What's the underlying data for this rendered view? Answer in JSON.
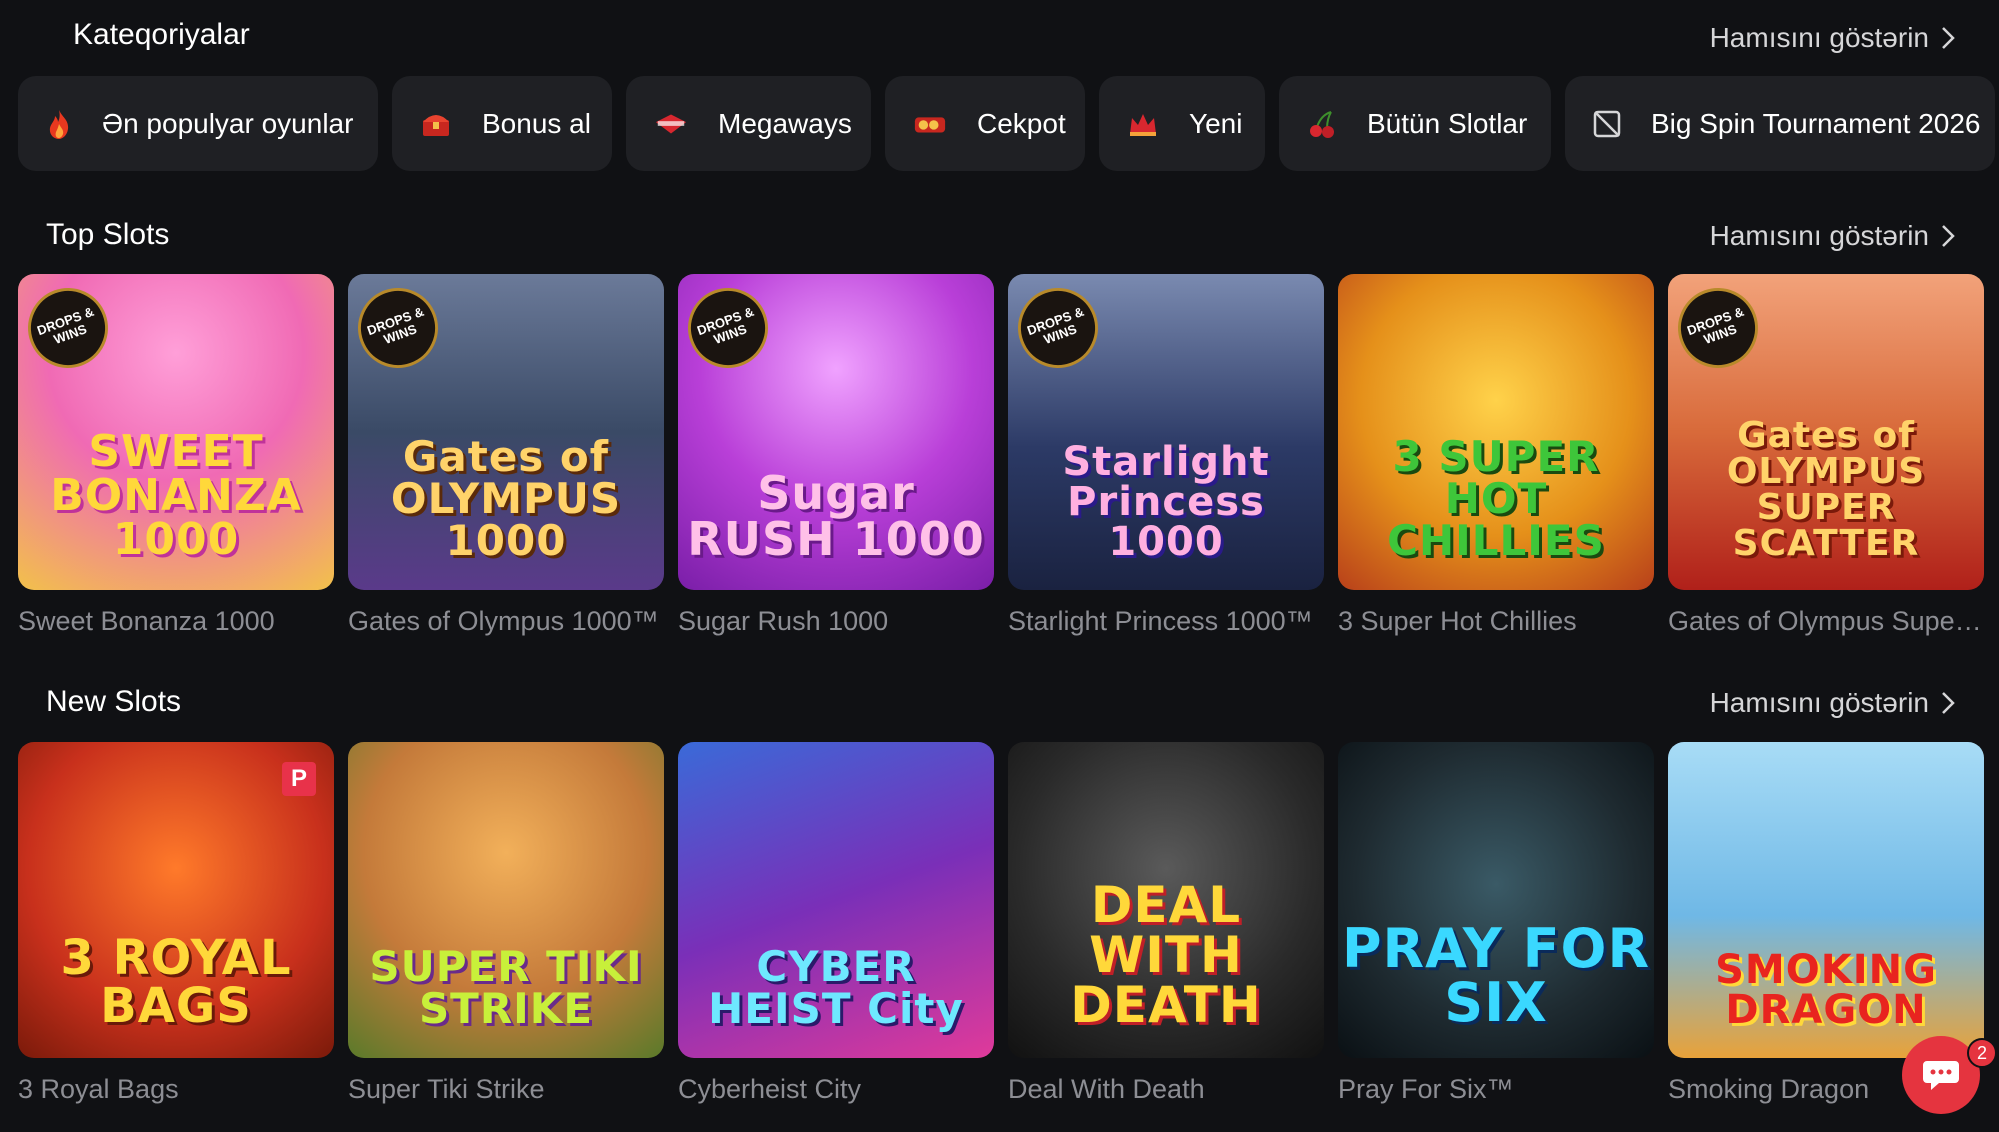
{
  "categories_section": {
    "title": "Kateqoriyalar",
    "see_all": "Hamısını göstərin",
    "items": [
      {
        "label": "Ən populyar oyunlar",
        "icon": "flame-icon"
      },
      {
        "label": "Bonus al",
        "icon": "treasure-chest-icon"
      },
      {
        "label": "Megaways",
        "icon": "megaways-icon"
      },
      {
        "label": "Cekpot",
        "icon": "jackpot-icon"
      },
      {
        "label": "Yeni",
        "icon": "crown-icon"
      },
      {
        "label": "Bütün Slotlar",
        "icon": "cherry-icon"
      },
      {
        "label": "Big Spin Tournament 2026",
        "icon": "image-placeholder-icon"
      }
    ]
  },
  "top_slots": {
    "title": "Top Slots",
    "see_all": "Hamısını göstərin",
    "games": [
      {
        "name": "Sweet Bonanza 1000",
        "logo": "SWEET BONANZA 1000",
        "badge": "DROPS & WINS",
        "bg": "#f07ac0"
      },
      {
        "name": "Gates of Olympus 1000™",
        "logo": "Gates of OLYMPUS 1000",
        "badge": "DROPS & WINS",
        "bg": "#3a4a66"
      },
      {
        "name": "Sugar Rush 1000",
        "logo": "Sugar RUSH 1000",
        "badge": "DROPS & WINS",
        "bg": "#b93fd8"
      },
      {
        "name": "Starlight Princess 1000™",
        "logo": "Starlight Princess 1000",
        "badge": "DROPS & WINS",
        "bg": "#2c3a66"
      },
      {
        "name": "3 Super Hot Chillies",
        "logo": "3 SUPER HOT CHILLIES",
        "badge": "",
        "bg": "#e5901a"
      },
      {
        "name": "Gates of Olympus Super Scatter",
        "logo": "Gates of OLYMPUS SUPER SCATTER",
        "badge": "DROPS & WINS",
        "bg": "#d86a3a"
      }
    ]
  },
  "new_slots": {
    "title": "New Slots",
    "see_all": "Hamısını göstərin",
    "games": [
      {
        "name": "3 Royal Bags",
        "logo": "3 ROYAL BAGS",
        "badge": "P",
        "bg": "#c8301c"
      },
      {
        "name": "Super Tiki Strike",
        "logo": "SUPER TIKI STRIKE",
        "badge": "",
        "bg": "#c47a3a"
      },
      {
        "name": "Cyberheist City",
        "logo": "CYBER HEIST City",
        "badge": "",
        "bg": "#7a2fb8"
      },
      {
        "name": "Deal With Death",
        "logo": "DEAL WITH DEATH",
        "badge": "",
        "bg": "#2a2a2a"
      },
      {
        "name": "Pray For Six™",
        "logo": "PRAY FOR SIX",
        "badge": "",
        "bg": "#1e2a30"
      },
      {
        "name": "Smoking Dragon",
        "logo": "SMOKING DRAGON",
        "badge": "",
        "bg": "#6fb8e6"
      }
    ]
  },
  "chat": {
    "icon": "chat-support-icon",
    "count": "2"
  },
  "colors": {
    "background": "#101114",
    "pill": "#1f2024",
    "accent": "#e5343f",
    "muted_text": "#8d8e94"
  }
}
